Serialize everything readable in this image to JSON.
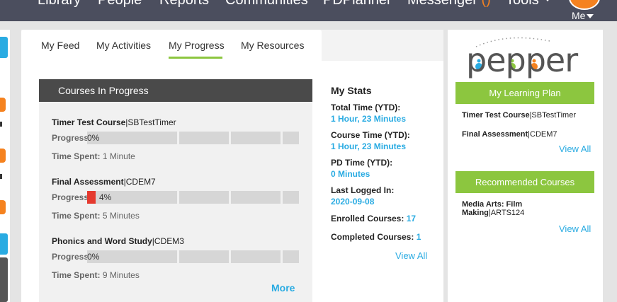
{
  "topnav": {
    "items": [
      "Library",
      "People",
      "Reports",
      "Communities",
      "PDPlanner",
      "Messenger",
      "Tools"
    ],
    "messenger_badge": "()",
    "me_label": "Me"
  },
  "tabs": [
    "My Feed",
    "My Activities",
    "My Progress",
    "My Resources"
  ],
  "active_tab": "My Progress",
  "courses_in_progress": {
    "title": "Courses In Progress",
    "progress_label": "Progress",
    "time_spent_label": "Time Spent:",
    "courses": [
      {
        "name": "Timer Test Course",
        "code": "|SBTestTimer",
        "progress_text": "0%",
        "progress": 0,
        "time_spent": "1 Minute"
      },
      {
        "name": "Final Assessment",
        "code": "|CDEM7",
        "progress_text": "4%",
        "progress": 4,
        "time_spent": "5 Minutes"
      },
      {
        "name": "Phonics and Word Study",
        "code": "|CDEM3",
        "progress_text": "0%",
        "progress": 0,
        "time_spent": "9 Minutes"
      }
    ],
    "more_label": "More"
  },
  "my_stats": {
    "title": "My Stats",
    "total_time_label": "Total Time (YTD):",
    "total_time_value": "1 Hour, 23 Minutes",
    "course_time_label": "Course Time (YTD):",
    "course_time_value": "1 Hour, 23 Minutes",
    "pd_time_label": "PD Time (YTD):",
    "pd_time_value": "0 Minutes",
    "last_logged_label": "Last Logged In:",
    "last_logged_value": "2020-09-08",
    "enrolled_label": "Enrolled Courses:",
    "enrolled_value": "17",
    "completed_label": "Completed Courses:",
    "completed_value": "1",
    "view_all": "View All"
  },
  "right_panel": {
    "logo_text": "pepper",
    "learning_plan": {
      "title": "My Learning Plan",
      "items": [
        {
          "name": "Timer Test Course",
          "code": "|SBTestTimer"
        },
        {
          "name": "Final Assessment",
          "code": "|CDEM7"
        }
      ],
      "view_all": "View All"
    },
    "recommended": {
      "title": "Recommended Courses",
      "item_line1": "Media Arts: Film",
      "item_line2_name": "Making",
      "item_line2_code": "|ARTS124",
      "view_all": "View All"
    }
  },
  "colors": {
    "nav_bg": "#4b4e5e",
    "accent_green": "#8cc63f",
    "link_blue": "#29abe2",
    "progress_red": "#e53a2f",
    "brand_orange": "#f5821f",
    "header_dark": "#4a4a4a"
  }
}
